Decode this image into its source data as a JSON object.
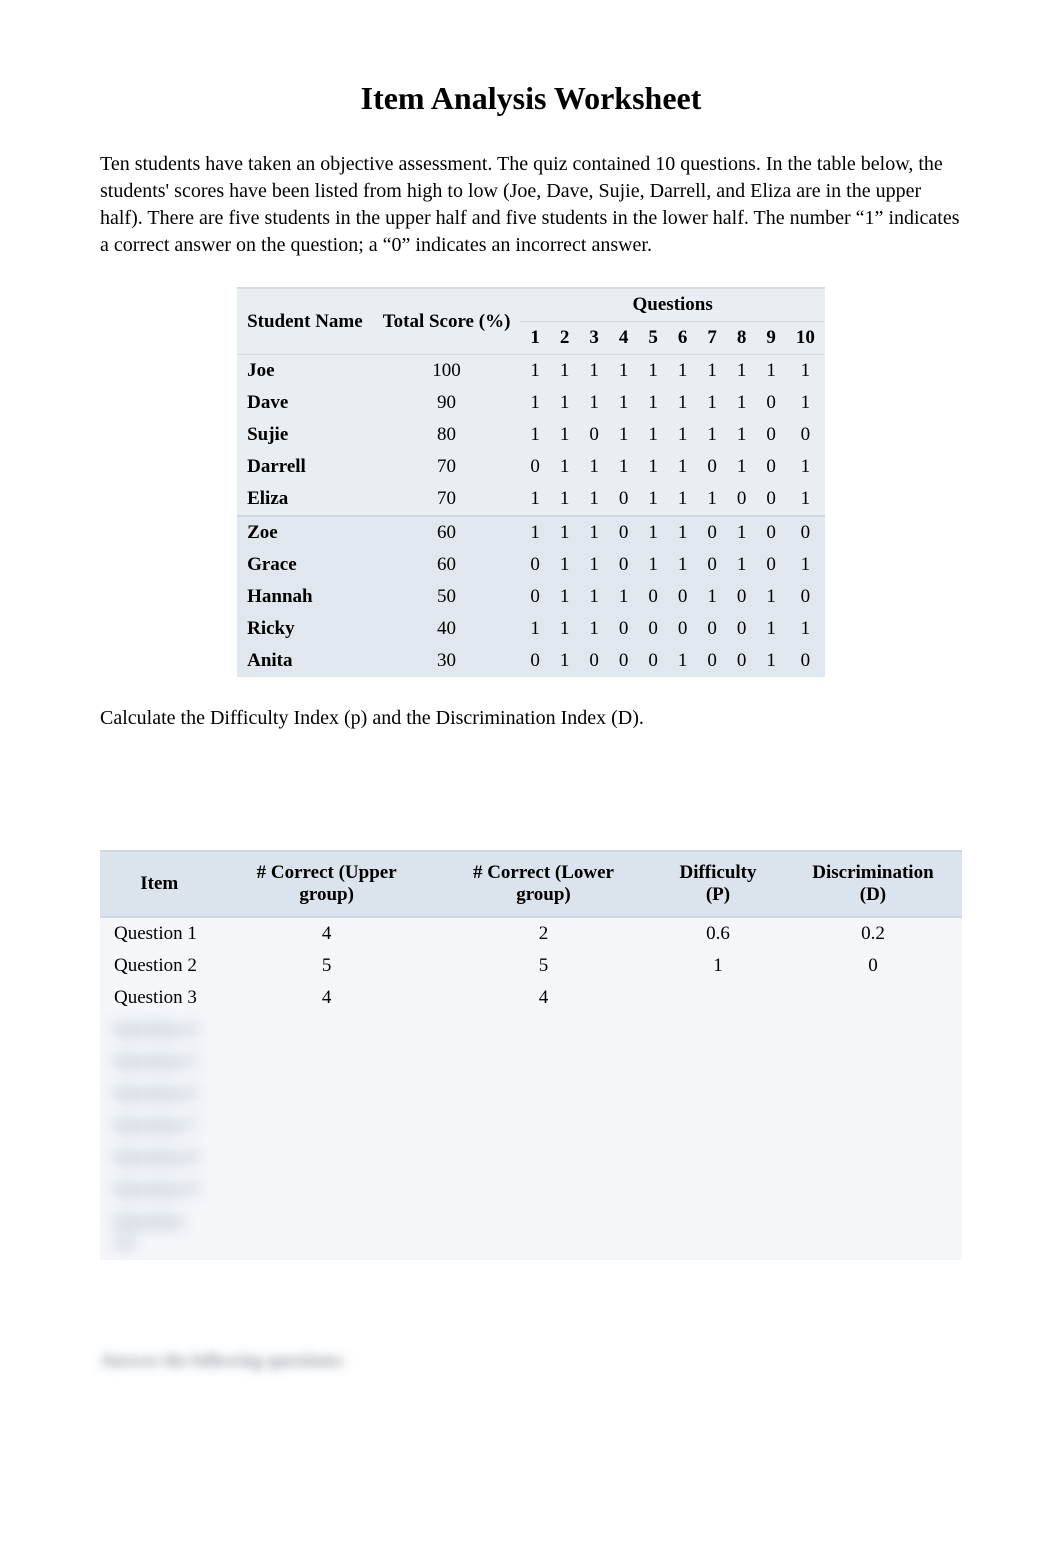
{
  "title": "Item Analysis Worksheet",
  "intro": "Ten students have taken an objective assessment.  The quiz contained 10 questions. In the table below, the students' scores have been listed from high to low (Joe, Dave, Sujie, Darrell, and Eliza are in the upper half). There are five students in the upper half and five students in the lower half. The number “1” indicates a correct answer on the question; a “0” indicates an incorrect answer.",
  "dataTable": {
    "headers": {
      "studentName": "Student Name",
      "totalScore": "Total Score (%)",
      "questions": "Questions",
      "cols": [
        "1",
        "2",
        "3",
        "4",
        "5",
        "6",
        "7",
        "8",
        "9",
        "10"
      ]
    },
    "upper": [
      {
        "name": "Joe",
        "score": "100",
        "a": [
          "1",
          "1",
          "1",
          "1",
          "1",
          "1",
          "1",
          "1",
          "1",
          "1"
        ]
      },
      {
        "name": "Dave",
        "score": "90",
        "a": [
          "1",
          "1",
          "1",
          "1",
          "1",
          "1",
          "1",
          "1",
          "0",
          "1"
        ]
      },
      {
        "name": "Sujie",
        "score": "80",
        "a": [
          "1",
          "1",
          "0",
          "1",
          "1",
          "1",
          "1",
          "1",
          "0",
          "0"
        ]
      },
      {
        "name": "Darrell",
        "score": "70",
        "a": [
          "0",
          "1",
          "1",
          "1",
          "1",
          "1",
          "0",
          "1",
          "0",
          "1"
        ]
      },
      {
        "name": "Eliza",
        "score": "70",
        "a": [
          "1",
          "1",
          "1",
          "0",
          "1",
          "1",
          "1",
          "0",
          "0",
          "1"
        ]
      }
    ],
    "lower": [
      {
        "name": "Zoe",
        "score": "60",
        "a": [
          "1",
          "1",
          "1",
          "0",
          "1",
          "1",
          "0",
          "1",
          "0",
          "0"
        ]
      },
      {
        "name": "Grace",
        "score": "60",
        "a": [
          "0",
          "1",
          "1",
          "0",
          "1",
          "1",
          "0",
          "1",
          "0",
          "1"
        ]
      },
      {
        "name": "Hannah",
        "score": "50",
        "a": [
          "0",
          "1",
          "1",
          "1",
          "0",
          "0",
          "1",
          "0",
          "1",
          "0"
        ]
      },
      {
        "name": "Ricky",
        "score": "40",
        "a": [
          "1",
          "1",
          "1",
          "0",
          "0",
          "0",
          "0",
          "0",
          "1",
          "1"
        ]
      },
      {
        "name": "Anita",
        "score": "30",
        "a": [
          "0",
          "1",
          "0",
          "0",
          "0",
          "1",
          "0",
          "0",
          "1",
          "0"
        ]
      }
    ]
  },
  "subhead": "Calculate the Difficulty Index (p) and the Discrimination Index (D).",
  "analysisTable": {
    "headers": {
      "item": "Item",
      "upper": "# Correct (Upper group)",
      "lower": "# Correct (Lower group)",
      "p": "Difficulty (P)",
      "d": "Discrimination (D)"
    },
    "rows": [
      {
        "item": "Question 1",
        "upper": "4",
        "lower": "2",
        "p": "0.6",
        "d": "0.2"
      },
      {
        "item": "Question 2",
        "upper": "5",
        "lower": "5",
        "p": "1",
        "d": "0"
      },
      {
        "item": "Question 3",
        "upper": "4",
        "lower": "4",
        "p": "",
        "d": ""
      }
    ],
    "blurredRows": [
      {
        "item": "Question 4",
        "upper": "",
        "lower": "",
        "p": "",
        "d": ""
      },
      {
        "item": "Question 5",
        "upper": "",
        "lower": "",
        "p": "",
        "d": ""
      },
      {
        "item": "Question 6",
        "upper": "",
        "lower": "",
        "p": "",
        "d": ""
      },
      {
        "item": "Question 7",
        "upper": "",
        "lower": "",
        "p": "",
        "d": ""
      },
      {
        "item": "Question 8",
        "upper": "",
        "lower": "",
        "p": "",
        "d": ""
      },
      {
        "item": "Question 9",
        "upper": "",
        "lower": "",
        "p": "",
        "d": ""
      },
      {
        "item": "Question 10",
        "upper": "",
        "lower": "",
        "p": "",
        "d": ""
      }
    ]
  },
  "blurredFooter": "Answer the following questions:"
}
